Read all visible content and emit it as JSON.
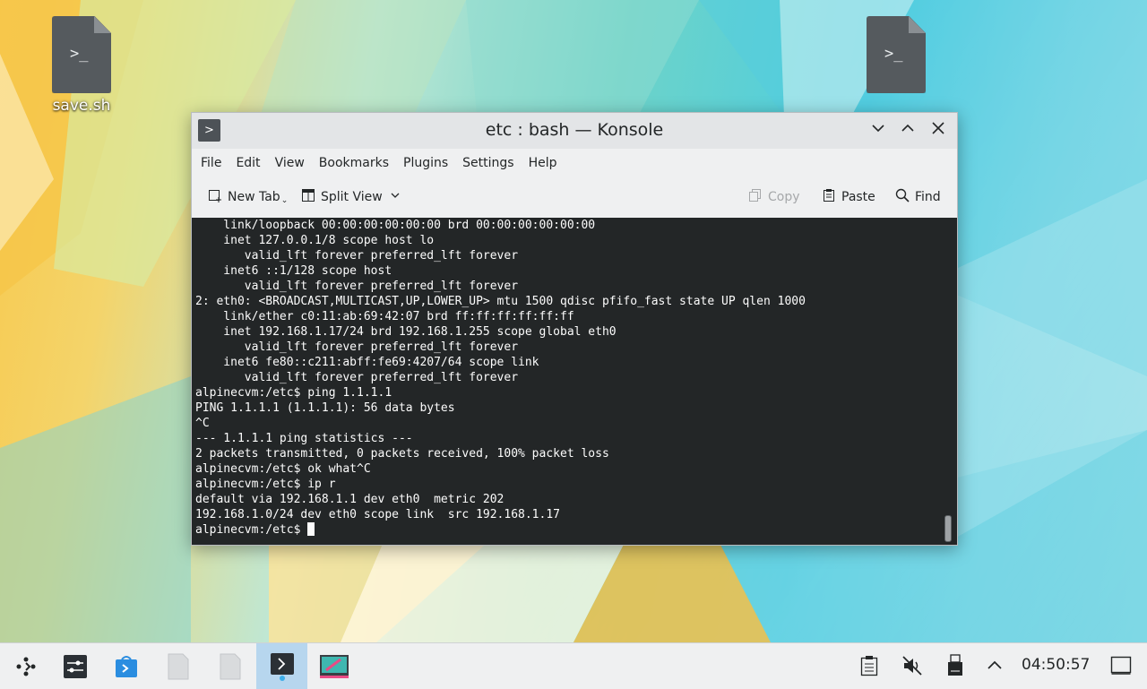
{
  "desktop": {
    "icons": [
      {
        "label": "save.sh",
        "glyph": ">_"
      },
      {
        "label": "",
        "glyph": ">_"
      }
    ]
  },
  "window": {
    "title": "etc : bash — Konsole",
    "app_icon": "terminal-icon",
    "controls": {
      "minimize": "chevron-down-icon",
      "maximize": "chevron-up-icon",
      "close": "close-icon"
    },
    "menu": [
      "File",
      "Edit",
      "View",
      "Bookmarks",
      "Plugins",
      "Settings",
      "Help"
    ],
    "toolbar": {
      "new_tab": "New Tab",
      "split_view": "Split View",
      "copy": "Copy",
      "paste": "Paste",
      "find": "Find"
    },
    "terminal_lines": [
      "    link/loopback 00:00:00:00:00:00 brd 00:00:00:00:00:00",
      "    inet 127.0.0.1/8 scope host lo",
      "       valid_lft forever preferred_lft forever",
      "    inet6 ::1/128 scope host",
      "       valid_lft forever preferred_lft forever",
      "2: eth0: <BROADCAST,MULTICAST,UP,LOWER_UP> mtu 1500 qdisc pfifo_fast state UP qlen 1000",
      "    link/ether c0:11:ab:69:42:07 brd ff:ff:ff:ff:ff:ff",
      "    inet 192.168.1.17/24 brd 192.168.1.255 scope global eth0",
      "       valid_lft forever preferred_lft forever",
      "    inet6 fe80::c211:abff:fe69:4207/64 scope link",
      "       valid_lft forever preferred_lft forever",
      "alpinecvm:/etc$ ping 1.1.1.1",
      "PING 1.1.1.1 (1.1.1.1): 56 data bytes",
      "^C",
      "--- 1.1.1.1 ping statistics ---",
      "2 packets transmitted, 0 packets received, 100% packet loss",
      "alpinecvm:/etc$ ok what^C",
      "alpinecvm:/etc$ ip r",
      "default via 192.168.1.1 dev eth0  metric 202",
      "192.168.1.0/24 dev eth0 scope link  src 192.168.1.17"
    ],
    "prompt": "alpinecvm:/etc$ "
  },
  "taskbar": {
    "clock": "04:50:57",
    "apps": [
      "app-launcher-icon",
      "system-settings-icon",
      "discover-store-icon",
      "file-icon",
      "file-icon",
      "konsole-icon",
      "krita-icon"
    ],
    "tray": [
      "clipboard-icon",
      "volume-muted-icon",
      "usb-drive-icon",
      "chevron-up-icon",
      "show-desktop-icon"
    ]
  },
  "colors": {
    "terminal_bg": "#232627",
    "terminal_fg": "#fcfcfc",
    "active_task": "#b7d6ee"
  }
}
